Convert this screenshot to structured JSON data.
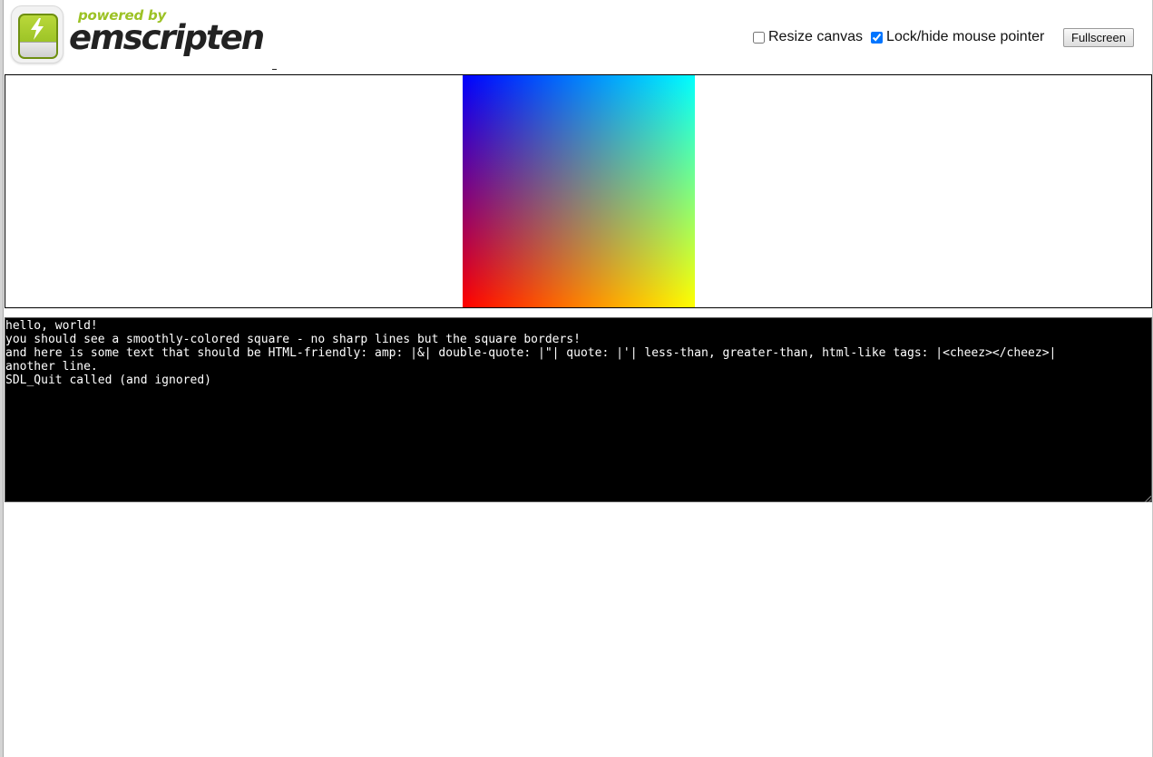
{
  "logo": {
    "powered_by": "powered by",
    "name": "emscripten",
    "brand_green": "#9cc225"
  },
  "controls": {
    "resize_canvas": {
      "label": "Resize canvas",
      "checked": false
    },
    "lock_pointer": {
      "label": "Lock/hide mouse pointer",
      "checked": true
    },
    "fullscreen_label": "Fullscreen"
  },
  "canvas": {
    "gradient_colors": {
      "top_left": "#0000ff",
      "top_right": "#00ffff",
      "bottom_left": "#ff0000",
      "bottom_right": "#ffff00"
    }
  },
  "output": {
    "lines": [
      "hello, world!",
      "you should see a smoothly-colored square - no sharp lines but the square borders!",
      "and here is some text that should be HTML-friendly: amp: |&| double-quote: |\"| quote: |'| less-than, greater-than, html-like tags: |<cheez></cheez>|",
      "another line.",
      "SDL_Quit called (and ignored)"
    ]
  }
}
